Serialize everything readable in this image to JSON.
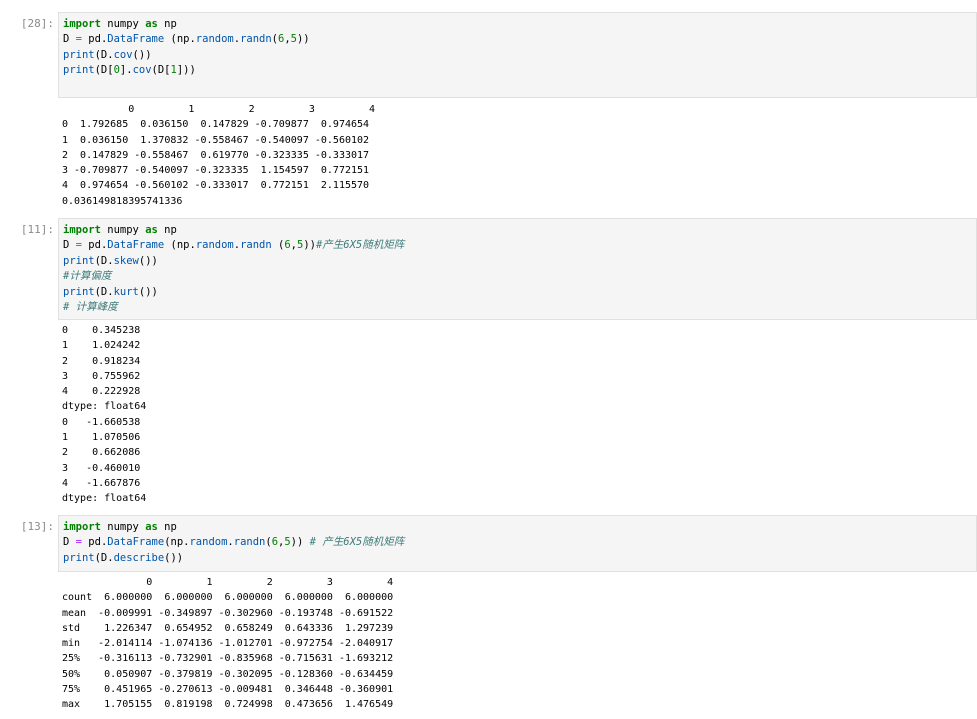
{
  "cells": [
    {
      "prompt": "[28]:",
      "code_lines": [
        [
          [
            "import",
            "kw"
          ],
          [
            " numpy ",
            ""
          ],
          [
            "as",
            "kw"
          ],
          [
            " np",
            ""
          ]
        ],
        [
          [
            "D ",
            ""
          ],
          [
            "=",
            "op"
          ],
          [
            " pd.",
            ""
          ],
          [
            "DataFrame",
            "fn"
          ],
          [
            " (np.",
            ""
          ],
          [
            "random",
            "fn"
          ],
          [
            ".",
            ""
          ],
          [
            "randn",
            "fn"
          ],
          [
            "(",
            ""
          ],
          [
            "6",
            "num"
          ],
          [
            ",",
            ""
          ],
          [
            "5",
            "num"
          ],
          [
            "))",
            ""
          ]
        ],
        [
          [
            "print",
            "fn"
          ],
          [
            "(D.",
            ""
          ],
          [
            "cov",
            "fn"
          ],
          [
            "())",
            ""
          ]
        ],
        [
          [
            "print",
            "fn"
          ],
          [
            "(D[",
            ""
          ],
          [
            "0",
            "num"
          ],
          [
            "].",
            ""
          ],
          [
            "cov",
            "fn"
          ],
          [
            "(D[",
            ""
          ],
          [
            "1",
            "num"
          ],
          [
            "]))",
            ""
          ]
        ]
      ],
      "output_lines": [
        "           0         1         2         3         4",
        "0  1.792685  0.036150  0.147829 -0.709877  0.974654",
        "1  0.036150  1.370832 -0.558467 -0.540097 -0.560102",
        "2  0.147829 -0.558467  0.619770 -0.323335 -0.333017",
        "3 -0.709877 -0.540097 -0.323335  1.154597  0.772151",
        "4  0.974654 -0.560102 -0.333017  0.772151  2.115570",
        "0.036149818395741336"
      ]
    },
    {
      "prompt": "[11]:",
      "code_lines": [
        [
          [
            "import",
            "kw"
          ],
          [
            " numpy ",
            ""
          ],
          [
            "as",
            "kw"
          ],
          [
            " np",
            ""
          ]
        ],
        [
          [
            "D ",
            ""
          ],
          [
            "=",
            "op"
          ],
          [
            " pd.",
            ""
          ],
          [
            "DataFrame",
            "fn"
          ],
          [
            " (np.",
            ""
          ],
          [
            "random",
            "fn"
          ],
          [
            ".",
            ""
          ],
          [
            "randn",
            "fn"
          ],
          [
            " (",
            ""
          ],
          [
            "6",
            "num"
          ],
          [
            ",",
            ""
          ],
          [
            "5",
            "num"
          ],
          [
            "))",
            ""
          ],
          [
            "#产生6X5随机矩阵",
            "cm"
          ]
        ],
        [
          [
            "print",
            "fn"
          ],
          [
            "(D.",
            ""
          ],
          [
            "skew",
            "fn"
          ],
          [
            "())",
            ""
          ]
        ],
        [
          [
            "#计算偏度",
            "cm"
          ]
        ],
        [
          [
            "print",
            "fn"
          ],
          [
            "(D.",
            ""
          ],
          [
            "kurt",
            "fn"
          ],
          [
            "())",
            ""
          ]
        ],
        [
          [
            "# 计算峰度",
            "cm"
          ]
        ]
      ],
      "output_lines": [
        "0    0.345238",
        "1    1.024242",
        "2    0.918234",
        "3    0.755962",
        "4    0.222928",
        "dtype: float64",
        "0   -1.660538",
        "1    1.070506",
        "2    0.662086",
        "3   -0.460010",
        "4   -1.667876",
        "dtype: float64"
      ]
    },
    {
      "prompt": "[13]:",
      "code_lines": [
        [
          [
            "import",
            "kw"
          ],
          [
            " numpy ",
            ""
          ],
          [
            "as",
            "kw"
          ],
          [
            " np",
            ""
          ]
        ],
        [
          [
            "D ",
            ""
          ],
          [
            "=",
            "op"
          ],
          [
            " pd.",
            ""
          ],
          [
            "DataFrame",
            "fn"
          ],
          [
            "(np.",
            ""
          ],
          [
            "random",
            "fn"
          ],
          [
            ".",
            ""
          ],
          [
            "randn",
            "fn"
          ],
          [
            "(",
            ""
          ],
          [
            "6",
            "num"
          ],
          [
            ",",
            ""
          ],
          [
            "5",
            "num"
          ],
          [
            ")) ",
            ""
          ],
          [
            "# 产生6X5随机矩阵",
            "cm"
          ]
        ],
        [
          [
            "print",
            "fn"
          ],
          [
            "(D.",
            ""
          ],
          [
            "describe",
            "fn"
          ],
          [
            "())",
            ""
          ]
        ]
      ],
      "output_lines": [
        "              0         1         2         3         4",
        "count  6.000000  6.000000  6.000000  6.000000  6.000000",
        "mean  -0.009991 -0.349897 -0.302960 -0.193748 -0.691522",
        "std    1.226347  0.654952  0.658249  0.643336  1.297239",
        "min   -2.014114 -1.074136 -1.012701 -0.972754 -2.040917",
        "25%   -0.316113 -0.732901 -0.835968 -0.715631 -1.693212",
        "50%    0.050907 -0.379819 -0.302095 -0.128360 -0.634459",
        "75%    0.451965 -0.270613 -0.009481  0.346448 -0.360901",
        "max    1.705155  0.819198  0.724998  0.473656  1.476549"
      ]
    }
  ]
}
